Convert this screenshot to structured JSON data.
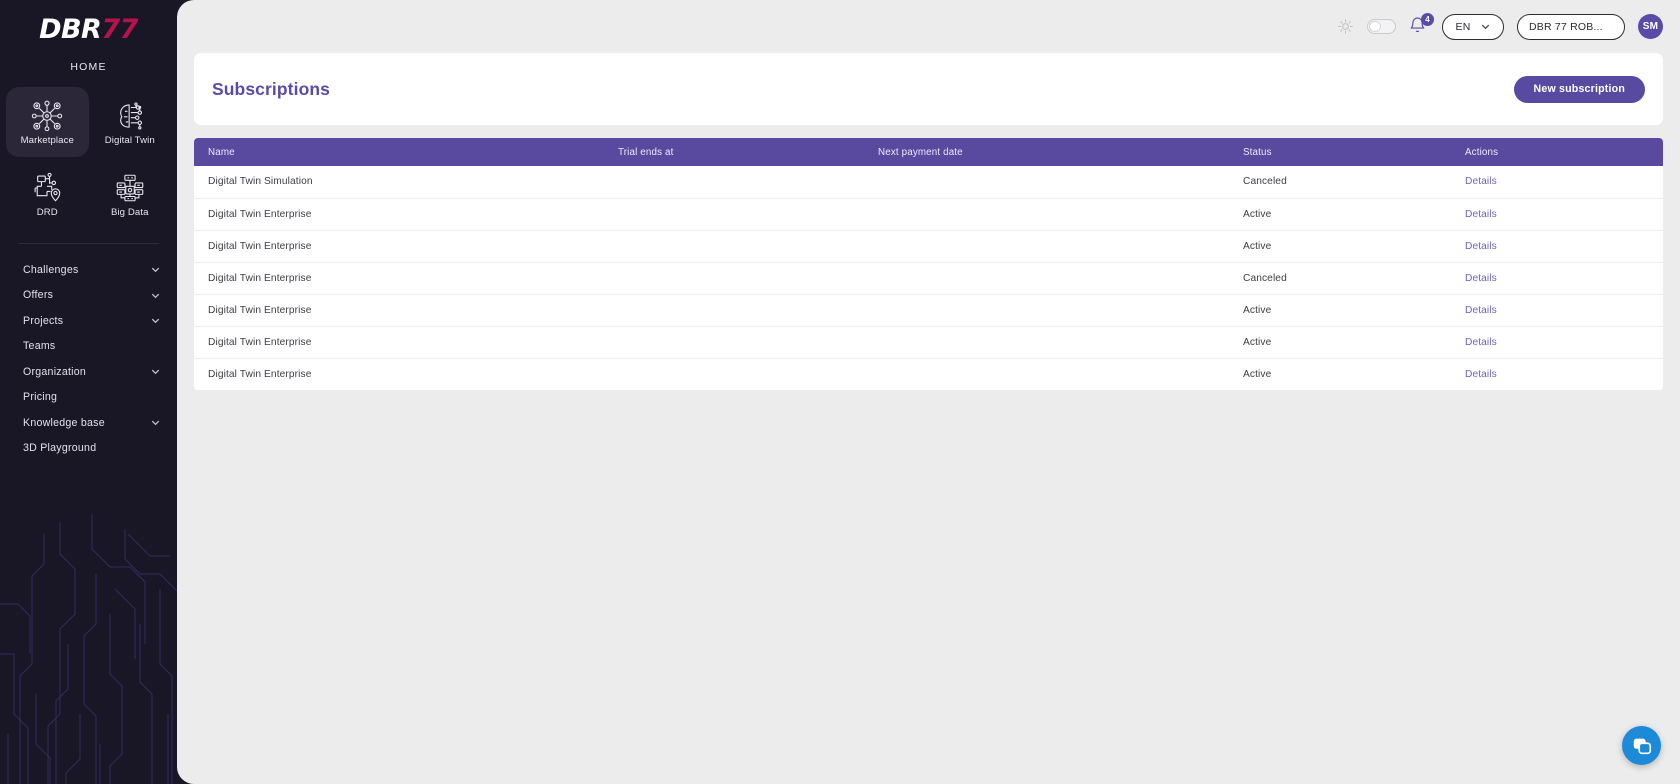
{
  "sidebar": {
    "logo": {
      "part1": "DBR",
      "part2": "77"
    },
    "home_label": "HOME",
    "tiles": [
      {
        "label": "Marketplace",
        "icon": "network-nodes-icon",
        "selected": true
      },
      {
        "label": "Digital Twin",
        "icon": "brain-circuit-icon",
        "selected": false
      },
      {
        "label": "DRD",
        "icon": "flow-map-pin-icon",
        "selected": false
      },
      {
        "label": "Big Data",
        "icon": "server-rack-icon",
        "selected": false
      }
    ],
    "menu": [
      {
        "label": "Challenges",
        "expandable": true
      },
      {
        "label": "Offers",
        "expandable": true
      },
      {
        "label": "Projects",
        "expandable": true
      },
      {
        "label": "Teams",
        "expandable": false
      },
      {
        "label": "Organization",
        "expandable": true
      },
      {
        "label": "Pricing",
        "expandable": false
      },
      {
        "label": "Knowledge base",
        "expandable": true
      },
      {
        "label": "3D Playground",
        "expandable": false
      }
    ]
  },
  "topbar": {
    "sun_icon": "sun-icon",
    "theme_toggle": "theme-toggle",
    "notifications_count": "4",
    "language": "EN",
    "organization": "DBR 77 ROB...",
    "avatar_initials": "SM"
  },
  "page": {
    "title": "Subscriptions",
    "new_subscription_label": "New subscription"
  },
  "table": {
    "columns": [
      "Name",
      "Trial ends at",
      "Next payment date",
      "Status",
      "Actions"
    ],
    "rows": [
      {
        "name": "Digital Twin Simulation",
        "trial_ends_at": "",
        "next_payment_date": "",
        "status": "Canceled",
        "action": "Details"
      },
      {
        "name": "Digital Twin Enterprise",
        "trial_ends_at": "",
        "next_payment_date": "",
        "status": "Active",
        "action": "Details"
      },
      {
        "name": "Digital Twin Enterprise",
        "trial_ends_at": "",
        "next_payment_date": "",
        "status": "Active",
        "action": "Details"
      },
      {
        "name": "Digital Twin Enterprise",
        "trial_ends_at": "",
        "next_payment_date": "",
        "status": "Canceled",
        "action": "Details"
      },
      {
        "name": "Digital Twin Enterprise",
        "trial_ends_at": "",
        "next_payment_date": "",
        "status": "Active",
        "action": "Details"
      },
      {
        "name": "Digital Twin Enterprise",
        "trial_ends_at": "",
        "next_payment_date": "",
        "status": "Active",
        "action": "Details"
      },
      {
        "name": "Digital Twin Enterprise",
        "trial_ends_at": "",
        "next_payment_date": "",
        "status": "Active",
        "action": "Details"
      }
    ]
  },
  "chat_widget": {
    "icon": "chat-bubble-icon"
  },
  "colors": {
    "brand_purple": "#574aa0",
    "brand_crimson": "#b8124b",
    "sidebar_bg": "#191626",
    "content_bg": "#ececec",
    "link_purple": "#6f63b4",
    "chat_blue": "#1c8ad6"
  }
}
